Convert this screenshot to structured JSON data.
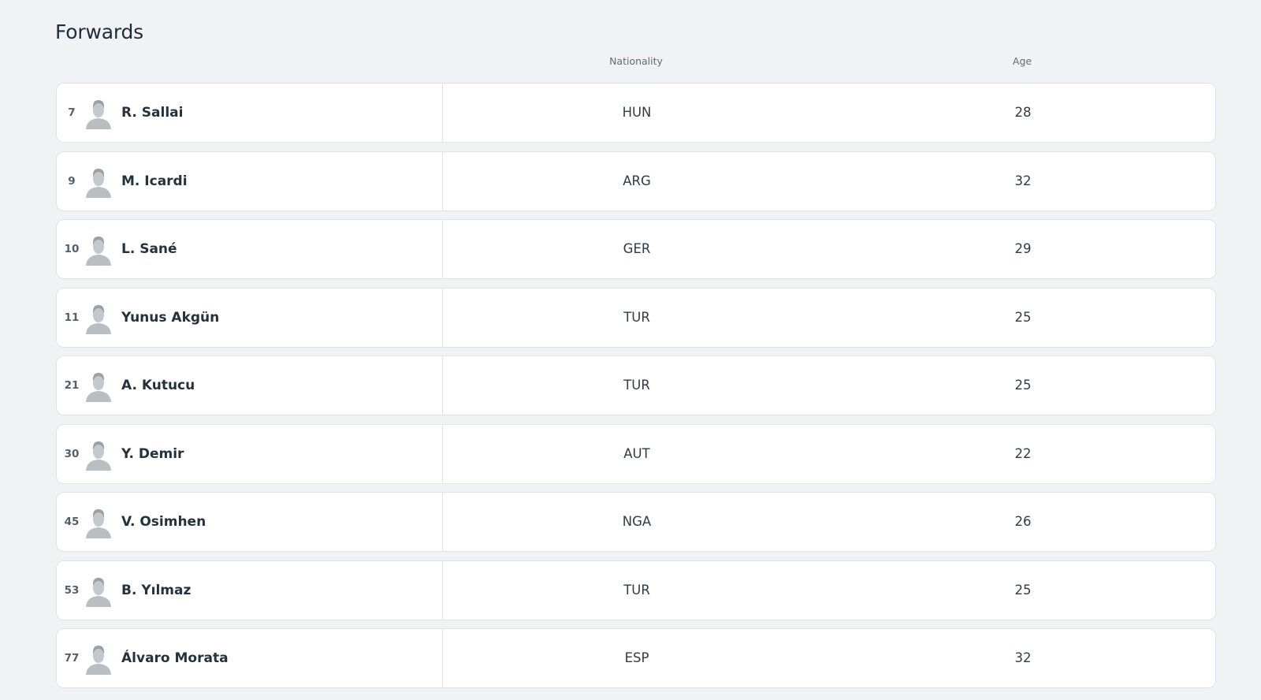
{
  "section": {
    "title": "Forwards"
  },
  "columns": {
    "nationality": "Nationality",
    "age": "Age"
  },
  "players": [
    {
      "number": "7",
      "name": "R. Sallai",
      "nationality": "HUN",
      "age": "28",
      "avatar_icon": "player-placeholder-icon"
    },
    {
      "number": "9",
      "name": "M. Icardi",
      "nationality": "ARG",
      "age": "32",
      "avatar_icon": "player-placeholder-icon"
    },
    {
      "number": "10",
      "name": "L. Sané",
      "nationality": "GER",
      "age": "29",
      "avatar_icon": "player-placeholder-icon"
    },
    {
      "number": "11",
      "name": "Yunus Akgün",
      "nationality": "TUR",
      "age": "25",
      "avatar_icon": "player-placeholder-icon"
    },
    {
      "number": "21",
      "name": "A. Kutucu",
      "nationality": "TUR",
      "age": "25",
      "avatar_icon": "player-placeholder-icon"
    },
    {
      "number": "30",
      "name": "Y. Demir",
      "nationality": "AUT",
      "age": "22",
      "avatar_icon": "player-placeholder-icon"
    },
    {
      "number": "45",
      "name": "V. Osimhen",
      "nationality": "NGA",
      "age": "26",
      "avatar_icon": "player-placeholder-icon"
    },
    {
      "number": "53",
      "name": "B. Yılmaz",
      "nationality": "TUR",
      "age": "25",
      "avatar_icon": "player-placeholder-icon"
    },
    {
      "number": "77",
      "name": "Álvaro Morata",
      "nationality": "ESP",
      "age": "32",
      "avatar_icon": "player-placeholder-icon"
    }
  ],
  "colors": {
    "background": "#f0f2f4",
    "card": "#ffffff",
    "border": "#dfe3e7",
    "text": "#24323e",
    "muted": "#5f6d78",
    "avatar": "#b9bec3"
  }
}
